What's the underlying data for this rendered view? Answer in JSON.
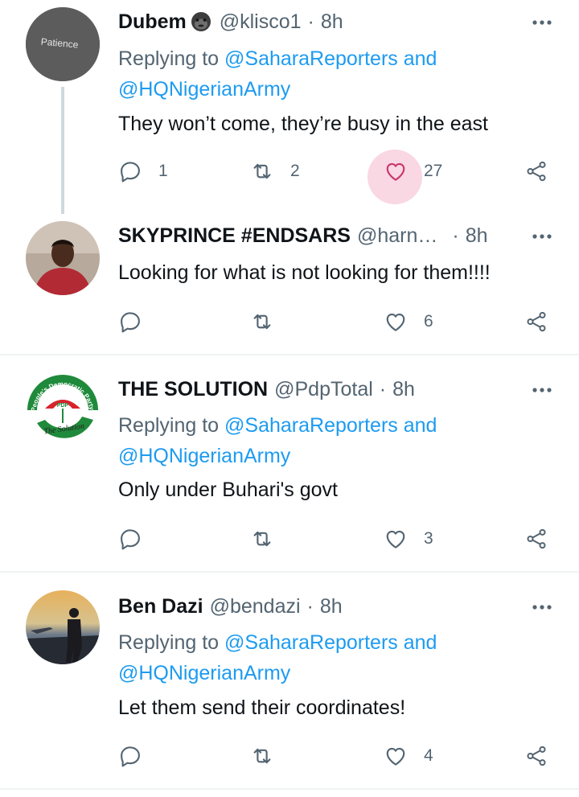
{
  "tweets": [
    {
      "name": "Dubem",
      "emoji": "gorilla-emoji",
      "handle": "@klisco1",
      "time": "8h",
      "replying_prefix": "Replying to ",
      "replying_link": "@SaharaReporters and",
      "replying_link2": "@HQNigerianArmy",
      "text": "They won’t come, they’re busy in the east",
      "replies": "1",
      "retweets": "2",
      "likes": "27",
      "avatar_label": "Patience",
      "avatar_color": "#5e5e5e",
      "liked": true
    },
    {
      "name": "SKYPRINCE #ENDSARS",
      "handle": "@harn…",
      "time": "8h",
      "text": "Looking for what is not looking for them!!!!",
      "replies": "",
      "retweets": "",
      "likes": "6"
    },
    {
      "name": "THE SOLUTION",
      "handle": "@PdpTotal",
      "time": "8h",
      "replying_prefix": "Replying to ",
      "replying_link": "@SaharaReporters and",
      "replying_link2": "@HQNigerianArmy",
      "text": "Only under Buhari's govt",
      "replies": "",
      "retweets": "",
      "likes": "3",
      "avatar_ring_text": "People's Democratic Party",
      "avatar_letters": "PDP",
      "avatar_script": "The Solution"
    },
    {
      "name": "Ben Dazi",
      "handle": "@bendazi",
      "time": "8h",
      "replying_prefix": "Replying to ",
      "replying_link": "@SaharaReporters and",
      "replying_link2": "@HQNigerianArmy",
      "text": "Let them send their coordinates!",
      "replies": "",
      "retweets": "",
      "likes": "4"
    }
  ],
  "colors": {
    "accent": "#1d9bf0",
    "secondary_text": "#536471",
    "like_highlight": "#f9d7e3",
    "pdp_green": "#1f8a3b",
    "pdp_red": "#d8232a"
  },
  "icons": [
    "more-icon",
    "reply-icon",
    "retweet-icon",
    "like-icon",
    "share-icon"
  ]
}
